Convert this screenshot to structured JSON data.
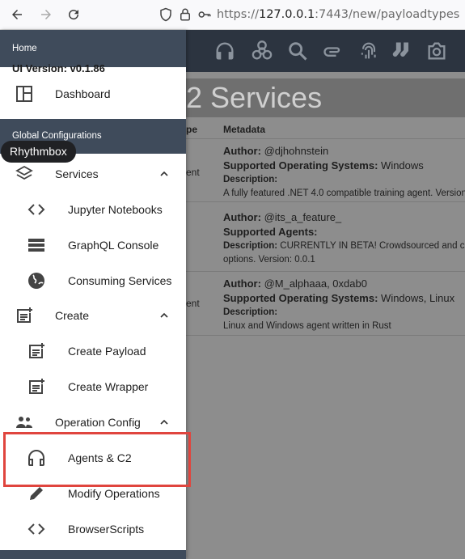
{
  "browser": {
    "url_scheme": "https://",
    "url_host": "127.0.0.1",
    "url_rest": ":7443/new/payloadtypes"
  },
  "background": {
    "page_heading": "2 Services",
    "columns": [
      "pe",
      "Metadata"
    ],
    "rows": [
      {
        "agent_type": "ent",
        "author_label": "Author:",
        "author": "@djhohnstein",
        "os_label": "Supported Operating Systems:",
        "os": "Windows",
        "desc_label": "Description:",
        "description": "A fully featured .NET 4.0 compatible training agent. Version"
      },
      {
        "agent_type": "",
        "author_label": "Author:",
        "author": "@its_a_feature_",
        "os_label": "Supported Agents:",
        "os": "",
        "desc_label": "Description:",
        "description": "CURRENTLY IN BETA! Crowdsourced and c",
        "description_2": "options. Version: 0.0.1"
      },
      {
        "agent_type": "ent",
        "author_label": "Author:",
        "author": "@M_alphaaa, 0xdab0",
        "os_label": "Supported Operating Systems:",
        "os": "Windows, Linux",
        "desc_label": "Description:",
        "description": "Linux and Windows agent written in Rust"
      }
    ]
  },
  "drawer": {
    "home_section": "Home",
    "version": "UI Version: v0.1.86",
    "global_section": "Global Configurations",
    "tooltip": "Rhythmbox",
    "items": {
      "dashboard": "Dashboard",
      "services": "Services",
      "jupyter": "Jupyter Notebooks",
      "graphql": "GraphQL Console",
      "consuming": "Consuming Services",
      "create": "Create",
      "create_payload": "Create Payload",
      "create_wrapper": "Create Wrapper",
      "operation_config": "Operation Config",
      "agents_c2": "Agents & C2",
      "modify_operations": "Modify Operations",
      "browser_scripts": "BrowserScripts"
    }
  },
  "colors": {
    "highlight": "#e0453e",
    "section_bg": "#3f4b5b",
    "topbar_bg": "#2c3440"
  }
}
